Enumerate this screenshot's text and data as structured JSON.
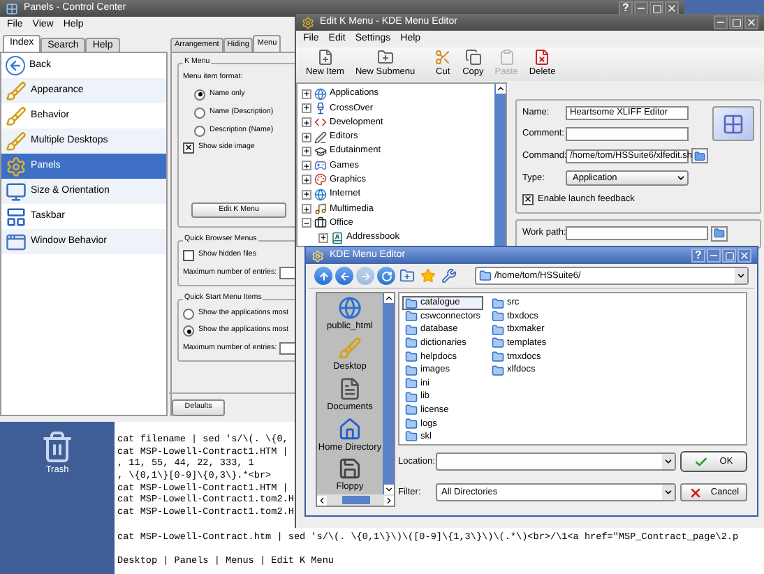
{
  "control_center": {
    "title": "Panels - Control Center",
    "help_button": "?",
    "menu": [
      "File",
      "View",
      "Help"
    ],
    "sidebar_tabs": [
      {
        "label": "Index",
        "selected": true
      },
      {
        "label": "Search",
        "selected": false
      },
      {
        "label": "Help",
        "selected": false
      }
    ],
    "modules": [
      {
        "label": "Back",
        "selected": false
      },
      {
        "label": "Appearance",
        "selected": false
      },
      {
        "label": "Behavior",
        "selected": false
      },
      {
        "label": "Multiple Desktops",
        "selected": false
      },
      {
        "label": "Panels",
        "selected": true
      },
      {
        "label": "Size & Orientation",
        "selected": false
      },
      {
        "label": "Taskbar",
        "selected": false
      },
      {
        "label": "Window Behavior",
        "selected": false
      }
    ],
    "tabs": [
      {
        "label": "Arrangement",
        "selected": false
      },
      {
        "label": "Hiding",
        "selected": false
      },
      {
        "label": "Menu",
        "selected": true
      }
    ],
    "k_menu": {
      "title": "K Menu",
      "format_label": "Menu item format:",
      "formats": [
        {
          "label": "Name only",
          "selected": true
        },
        {
          "label": "Name (Description)",
          "selected": false
        },
        {
          "label": "Description (Name)",
          "selected": false
        }
      ],
      "side_image": {
        "label": "Show side image",
        "checked": true
      },
      "edit_button": "Edit K Menu"
    },
    "quick_browser": {
      "title": "Quick Browser Menus",
      "hidden_files": {
        "label": "Show hidden files",
        "checked": false
      },
      "max_label": "Maximum number of entries:"
    },
    "quick_start": {
      "title": "Quick Start Menu Items",
      "options": [
        {
          "label": "Show the applications most",
          "selected": false
        },
        {
          "label": "Show the applications most",
          "selected": true
        }
      ],
      "max_label": "Maximum number of entries:"
    },
    "defaults_button": "Defaults"
  },
  "menu_editor": {
    "title": "Edit K Menu - KDE Menu Editor",
    "menu": [
      "File",
      "Edit",
      "Settings",
      "Help"
    ],
    "toolbar": [
      {
        "label": "New Item",
        "disabled": false
      },
      {
        "label": "New Submenu",
        "disabled": false
      },
      {
        "label": "Cut",
        "disabled": false
      },
      {
        "label": "Copy",
        "disabled": false
      },
      {
        "label": "Paste",
        "disabled": true
      },
      {
        "label": "Delete",
        "disabled": false
      }
    ],
    "tree": [
      {
        "label": "Applications",
        "expanded": false
      },
      {
        "label": "CrossOver",
        "expanded": false
      },
      {
        "label": "Development",
        "expanded": false
      },
      {
        "label": "Editors",
        "expanded": false
      },
      {
        "label": "Edutainment",
        "expanded": false
      },
      {
        "label": "Games",
        "expanded": false
      },
      {
        "label": "Graphics",
        "expanded": false
      },
      {
        "label": "Internet",
        "expanded": false
      },
      {
        "label": "Multimedia",
        "expanded": false
      },
      {
        "label": "Office",
        "expanded": true,
        "children": [
          {
            "label": "Addressbook",
            "expanded": false
          }
        ]
      }
    ],
    "form": {
      "name_label": "Name:",
      "name": "Heartsome XLIFF Editor",
      "comment_label": "Comment:",
      "command_label": "Command:",
      "command": "/home/tom/HSSuite6/xlfedit.sh",
      "type_label": "Type:",
      "type": "Application",
      "launch_feedback": {
        "label": "Enable launch feedback",
        "checked": true
      },
      "work_path_label": "Work path:"
    }
  },
  "file_dialog": {
    "title": "KDE Menu Editor",
    "help_button": "?",
    "path": "/home/tom/HSSuite6/",
    "places": [
      {
        "label": "public_html"
      },
      {
        "label": "Desktop"
      },
      {
        "label": "Documents"
      },
      {
        "label": "Home Directory"
      },
      {
        "label": "Floppy"
      }
    ],
    "files": [
      {
        "label": "catalogue",
        "selected": true
      },
      {
        "label": "cswconnectors",
        "selected": false
      },
      {
        "label": "database",
        "selected": false
      },
      {
        "label": "dictionaries",
        "selected": false
      },
      {
        "label": "helpdocs",
        "selected": false
      },
      {
        "label": "images",
        "selected": false
      },
      {
        "label": "ini",
        "selected": false
      },
      {
        "label": "lib",
        "selected": false
      },
      {
        "label": "license",
        "selected": false
      },
      {
        "label": "logs",
        "selected": false
      },
      {
        "label": "skl",
        "selected": false
      },
      {
        "label": "src",
        "selected": false
      },
      {
        "label": "tbxdocs",
        "selected": false
      },
      {
        "label": "tbxmaker",
        "selected": false
      },
      {
        "label": "templates",
        "selected": false
      },
      {
        "label": "tmxdocs",
        "selected": false
      },
      {
        "label": "xlfdocs",
        "selected": false
      }
    ],
    "location_label": "Location:",
    "filter_label": "Filter:",
    "filter": "All Directories",
    "ok_button": "OK",
    "cancel_button": "Cancel"
  },
  "desktop": {
    "icons": [
      {
        "label": "Trash"
      }
    ],
    "terminal_blocks": [
      {
        "lines": [
          "cat filename | sed 's/\\(. \\{0,",
          "cat MSP-Lowell-Contract1.HTM |",
          ", 11, 55, 44, 22, 333, 1",
          ", \\{0,1\\}[0-9]\\{0,3\\}.*<br>",
          "cat MSP-Lowell-Contract1.HTM |",
          "cat MSP-Lowell-Contract1.tom2.H",
          "cat MSP-Lowell-Contract1.tom2.H"
        ]
      },
      {
        "lines": [
          "cat MSP-Lowell-Contract.htm | sed 's/\\(. \\{0,1\\}\\)\\([0-9]\\{1,3\\}\\)\\(.*\\)<br>/\\1<a href=\"MSP_Contract_page\\2.p"
        ]
      },
      {
        "lines": [
          "Desktop | Panels | Menus | Edit K Menu"
        ]
      }
    ]
  }
}
